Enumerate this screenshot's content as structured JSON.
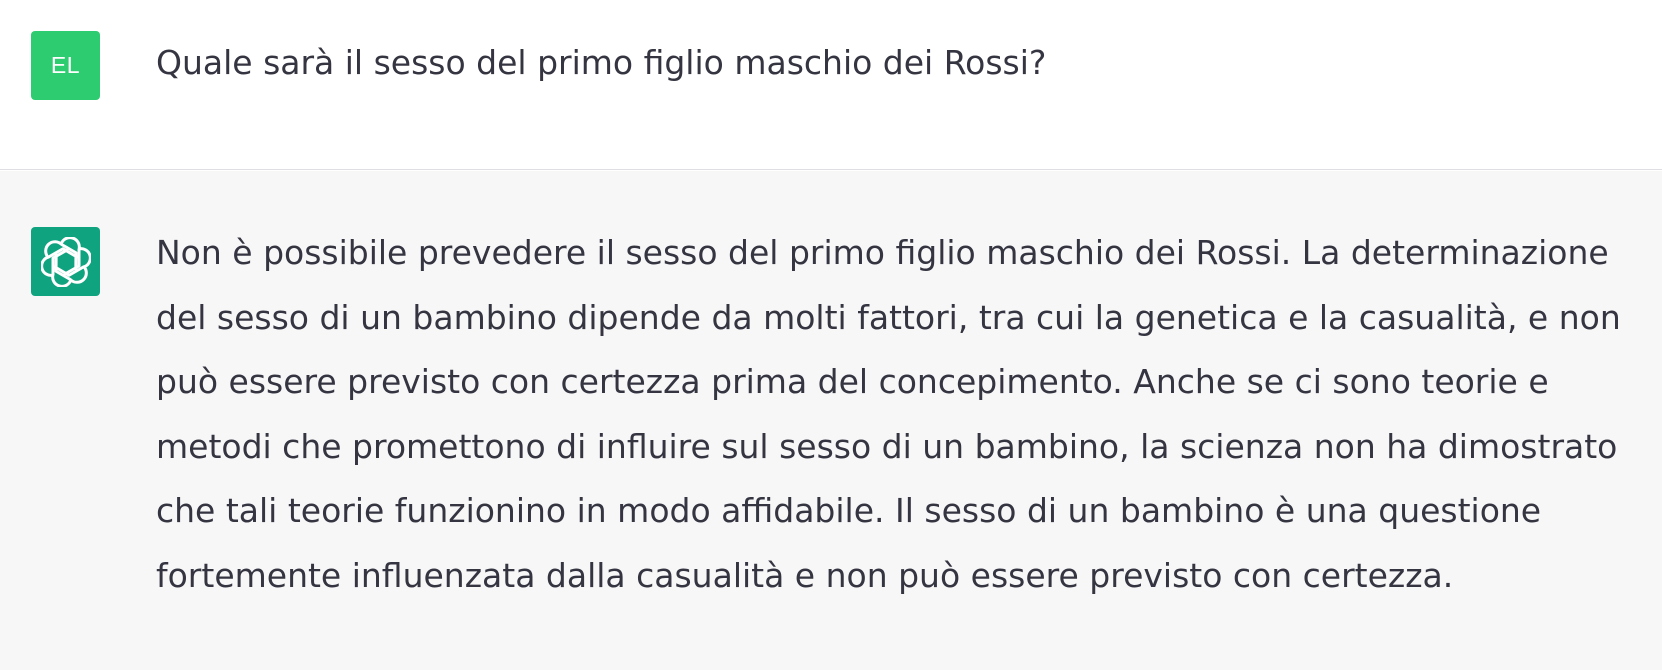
{
  "conversation": {
    "user_message": {
      "avatar_initials": "EL",
      "avatar_color": "#2ecc71",
      "text": "Quale sarà il sesso del primo figlio maschio dei Rossi?"
    },
    "assistant_message": {
      "avatar_icon": "openai-logo-icon",
      "avatar_color": "#10a37f",
      "text": "Non è possibile prevedere il sesso del primo figlio maschio dei Rossi. La determinazione del sesso di un bambino dipende da molti fattori, tra cui la genetica e la casualità, e non può essere previsto con certezza prima del concepimento. Anche se ci sono teorie e metodi che promettono di influire sul sesso di un bambino, la scienza non ha dimostrato che tali teorie funzionino in modo affidabile. Il sesso di un bambino è una questione fortemente influenzata dalla casualità e non può essere previsto con certezza."
    }
  }
}
